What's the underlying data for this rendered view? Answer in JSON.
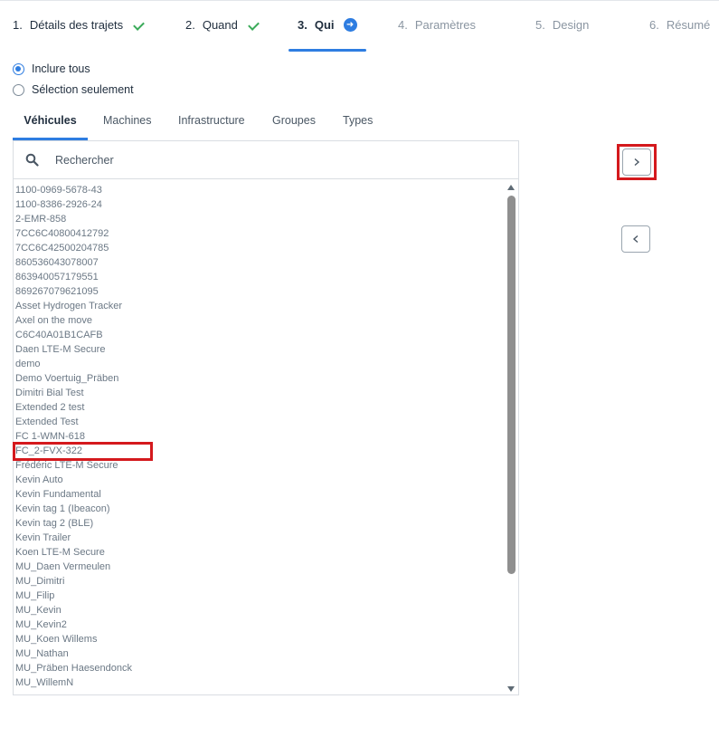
{
  "stepper": {
    "steps": [
      {
        "num": "1.",
        "label": "Détails des trajets",
        "state": "done"
      },
      {
        "num": "2.",
        "label": "Quand",
        "state": "done"
      },
      {
        "num": "3.",
        "label": "Qui",
        "state": "active"
      },
      {
        "num": "4.",
        "label": "Paramètres",
        "state": "future"
      },
      {
        "num": "5.",
        "label": "Design",
        "state": "future"
      },
      {
        "num": "6.",
        "label": "Résumé",
        "state": "future"
      }
    ]
  },
  "selection": {
    "options": [
      {
        "label": "Inclure tous",
        "selected": true
      },
      {
        "label": "Sélection seulement",
        "selected": false
      }
    ]
  },
  "tabs": [
    "Véhicules",
    "Machines",
    "Infrastructure",
    "Groupes",
    "Types"
  ],
  "active_tab": "Véhicules",
  "search": {
    "placeholder": "Rechercher",
    "value": ""
  },
  "vehicles": [
    "1100-0969-5678-43",
    "1100-8386-2926-24",
    "2-EMR-858",
    "7CC6C40800412792",
    "7CC6C42500204785",
    "860536043078007",
    "863940057179551",
    "869267079621095",
    "Asset Hydrogen Tracker",
    "Axel on the move",
    "C6C40A01B1CAFB",
    "Daen LTE-M Secure",
    "demo",
    "Demo Voertuig_Präben",
    "Dimitri Bial Test",
    "Extended 2 test",
    "Extended Test",
    "FC 1-WMN-618",
    "FC_2-FVX-322",
    "Frédéric LTE-M Secure",
    "Kevin Auto",
    "Kevin Fundamental",
    "Kevin tag 1 (Ibeacon)",
    "Kevin tag 2 (BLE)",
    "Kevin Trailer",
    "Koen LTE-M Secure",
    "MU_Daen Vermeulen",
    "MU_Dimitri",
    "MU_Filip",
    "MU_Kevin",
    "MU_Kevin2",
    "MU_Koen Willems",
    "MU_Nathan",
    "MU_Präben Haesendonck",
    "MU_WillemN"
  ],
  "highlighted_item": "FC_2-FVX-322",
  "scroll_position": 0,
  "icons": {
    "step_done": "check-icon",
    "step_active": "arrow-right-circle-icon",
    "search": "search-icon",
    "add": "chevron-right-icon",
    "remove": "chevron-left-icon"
  },
  "colors": {
    "accent": "#2e7de1",
    "done": "#3bab5a",
    "highlight": "#d4191d",
    "text": "#1f2d3d",
    "muted": "#8a95a1"
  }
}
